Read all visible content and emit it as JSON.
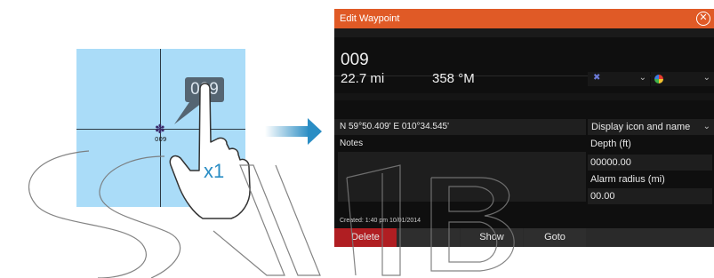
{
  "illustration": {
    "waypoint_label": "009",
    "bubble_text": "009",
    "tap_count": "x1",
    "colors": {
      "chart_water": "#aadcf8",
      "arrow": "#2a8dc4"
    }
  },
  "dialog": {
    "title": "Edit Waypoint",
    "close_icon": "close-circle-icon",
    "name": "009",
    "distance": "22.7 mi",
    "bearing": "358 °M",
    "icon_select": {
      "icon": "waypoint-symbol-icon"
    },
    "color_select": {
      "icon": "color-wheel-icon"
    },
    "position": "N 59°50.409'   E 010°34.545'",
    "display_mode": "Display icon and name",
    "notes_label": "Notes",
    "notes_value": "",
    "depth_label": "Depth (ft)",
    "depth_value": "00000.00",
    "alarm_label": "Alarm radius (mi)",
    "alarm_value": "00.00",
    "created": "Created: 1:40 pm  10/01/2014",
    "buttons": {
      "delete": "Delete",
      "show": "Show",
      "goto": "Goto"
    },
    "colors": {
      "titlebar": "#e05a26",
      "delete": "#b01e22",
      "background": "#0f0f0f"
    }
  }
}
